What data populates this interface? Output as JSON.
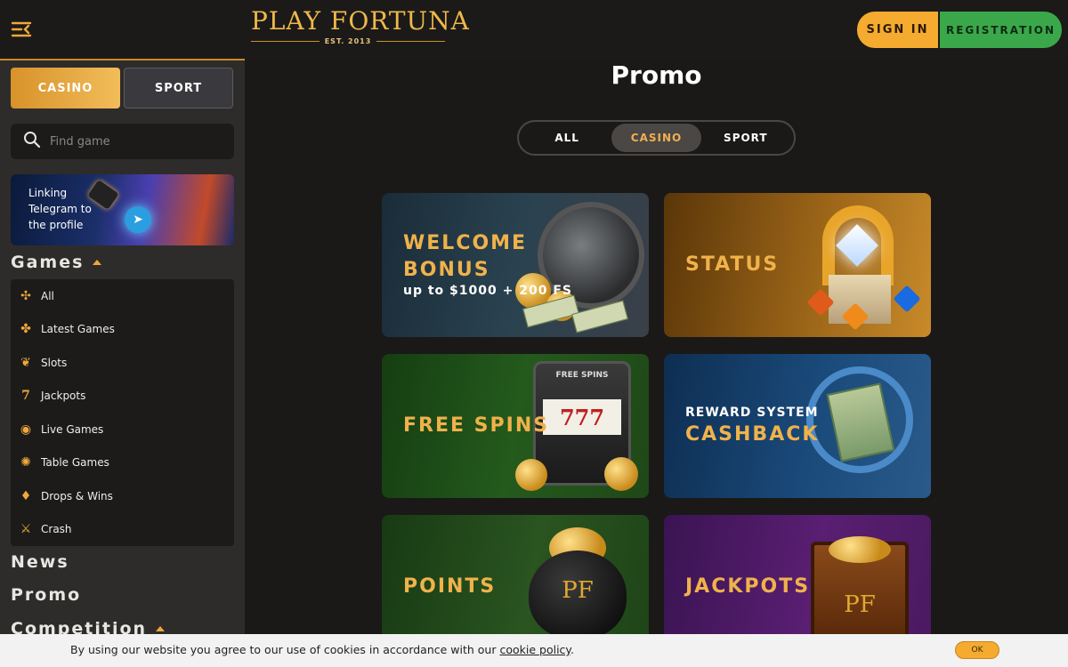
{
  "header": {
    "logo_text": "PLAY FORTUNA",
    "logo_tagline": "EST. 2013",
    "signin_label": "SIGN IN",
    "registration_label": "REGISTRATION"
  },
  "sidebar": {
    "tabs": [
      {
        "label": "CASINO",
        "active": true
      },
      {
        "label": "SPORT",
        "active": false
      }
    ],
    "search": {
      "placeholder": "Find game"
    },
    "telegram_banner": "Linking Telegram to the profile",
    "games_title": "Games",
    "games": [
      {
        "label": "All",
        "icon": "grid-icon"
      },
      {
        "label": "Latest Games",
        "icon": "clover-icon"
      },
      {
        "label": "Slots",
        "icon": "cherry-icon"
      },
      {
        "label": "Jackpots",
        "icon": "seven-icon"
      },
      {
        "label": "Live Games",
        "icon": "broadcast-icon"
      },
      {
        "label": "Table Games",
        "icon": "chip-icon"
      },
      {
        "label": "Drops & Wins",
        "icon": "drops-icon"
      },
      {
        "label": "Crash",
        "icon": "swords-icon"
      }
    ],
    "news_title": "News",
    "promo_title": "Promo",
    "competition_title": "Competition"
  },
  "main": {
    "title": "Promo",
    "filters": [
      {
        "label": "ALL",
        "active": false
      },
      {
        "label": "CASINO",
        "active": true
      },
      {
        "label": "SPORT",
        "active": false
      }
    ],
    "cards": [
      {
        "title_line1": "WELCOME",
        "title_line2": "BONUS",
        "subtitle": "up to $1000 + 200 FS"
      },
      {
        "title": "STATUS"
      },
      {
        "title": "FREE SPINS",
        "slot_label": "FREE SPINS",
        "slot_digits": "777"
      },
      {
        "pre_title": "REWARD SYSTEM",
        "title": "CASHBACK"
      },
      {
        "title": "POINTS",
        "pot_text": "PF"
      },
      {
        "title": "JACKPOTS",
        "chest_text": "PF"
      }
    ]
  },
  "cookie": {
    "message": "By using our website you agree to our use of cookies in accordance with our ",
    "link": "cookie policy",
    "suffix": ".",
    "ok_label": "OK"
  },
  "colors": {
    "accent": "#f5ab2f",
    "registration": "#3aa84a",
    "background": "#1a1918",
    "sidebar": "#2e2c2a"
  }
}
